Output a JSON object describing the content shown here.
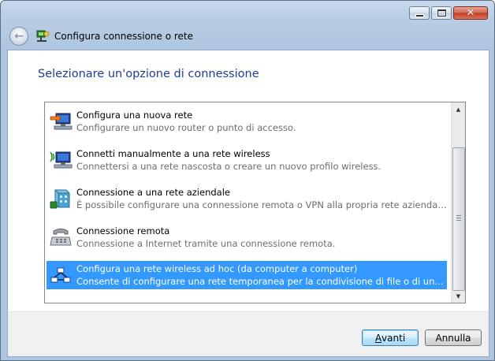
{
  "window": {
    "title": "Configura connessione o rete",
    "caption_buttons": [
      "minimize",
      "maximize",
      "close"
    ]
  },
  "heading": "Selezionare un'opzione di connessione",
  "options": [
    {
      "title": "Configura una nuova rete",
      "description": "Configurare un nuovo router o punto di accesso.",
      "icon": "new-network-icon",
      "selected": false
    },
    {
      "title": "Connetti manualmente a una rete wireless",
      "description": "Connettersi a una rete nascosta o creare un nuovo profilo wireless.",
      "icon": "wireless-network-icon",
      "selected": false
    },
    {
      "title": "Connessione a una rete aziendale",
      "description": "È possibile configurare una connessione remota o VPN alla propria rete aziendale.",
      "icon": "workplace-network-icon",
      "selected": false
    },
    {
      "title": "Connessione remota",
      "description": "Connessione a Internet tramite una connessione remota.",
      "icon": "dialup-phone-icon",
      "selected": false
    },
    {
      "title": "Configura una rete wireless ad hoc (da computer a computer)",
      "description": "Consente di configurare una rete temporanea per la condivisione di file o di una connes…",
      "icon": "adhoc-network-icon",
      "selected": true
    }
  ],
  "buttons": {
    "next_access_key": "A",
    "next_rest": "vanti",
    "cancel": "Annulla"
  },
  "colors": {
    "heading": "#1e3d92",
    "selection": "#3399ff"
  }
}
